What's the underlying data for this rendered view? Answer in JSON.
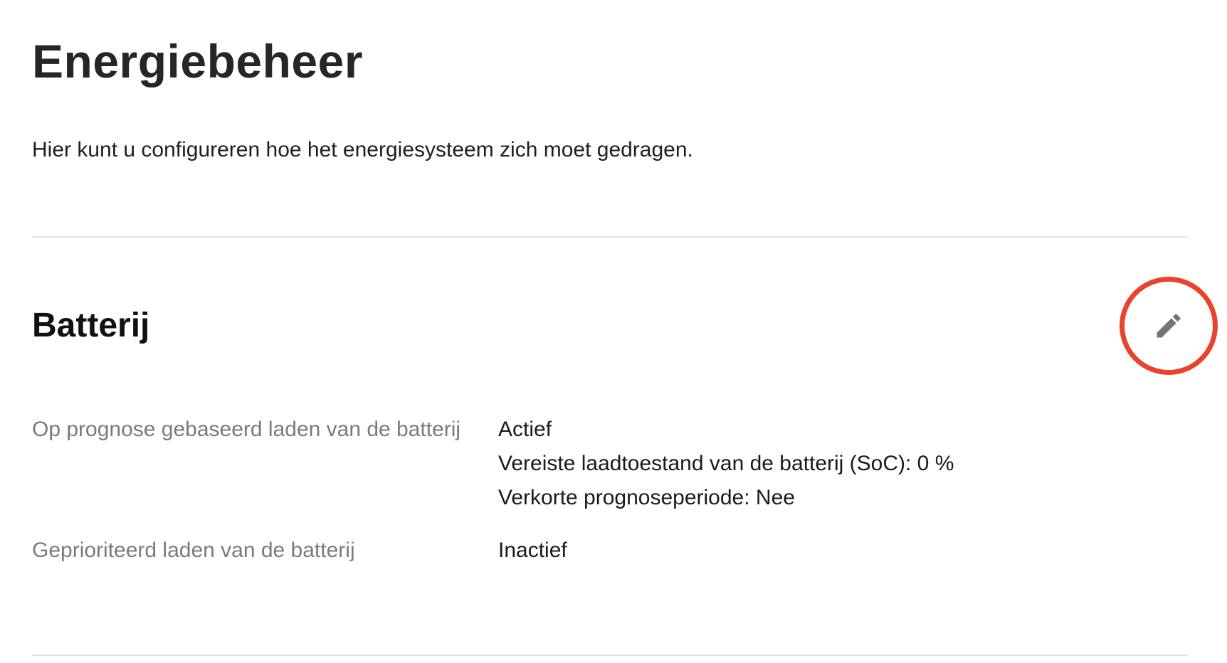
{
  "header": {
    "title": "Energiebeheer",
    "description": "Hier kunt u configureren hoe het energiesysteem zich moet gedragen."
  },
  "battery_section": {
    "title": "Batterij",
    "edit_icon": "pencil-icon",
    "accent_color": "#e8432d",
    "settings": [
      {
        "label": "Op prognose gebaseerd laden van de batterij",
        "values": [
          "Actief",
          "Vereiste laadtoestand van de batterij (SoC): 0 %",
          "Verkorte prognoseperiode: Nee"
        ]
      },
      {
        "label": "Geprioriteerd laden van de batterij",
        "values": [
          "Inactief"
        ]
      }
    ]
  }
}
